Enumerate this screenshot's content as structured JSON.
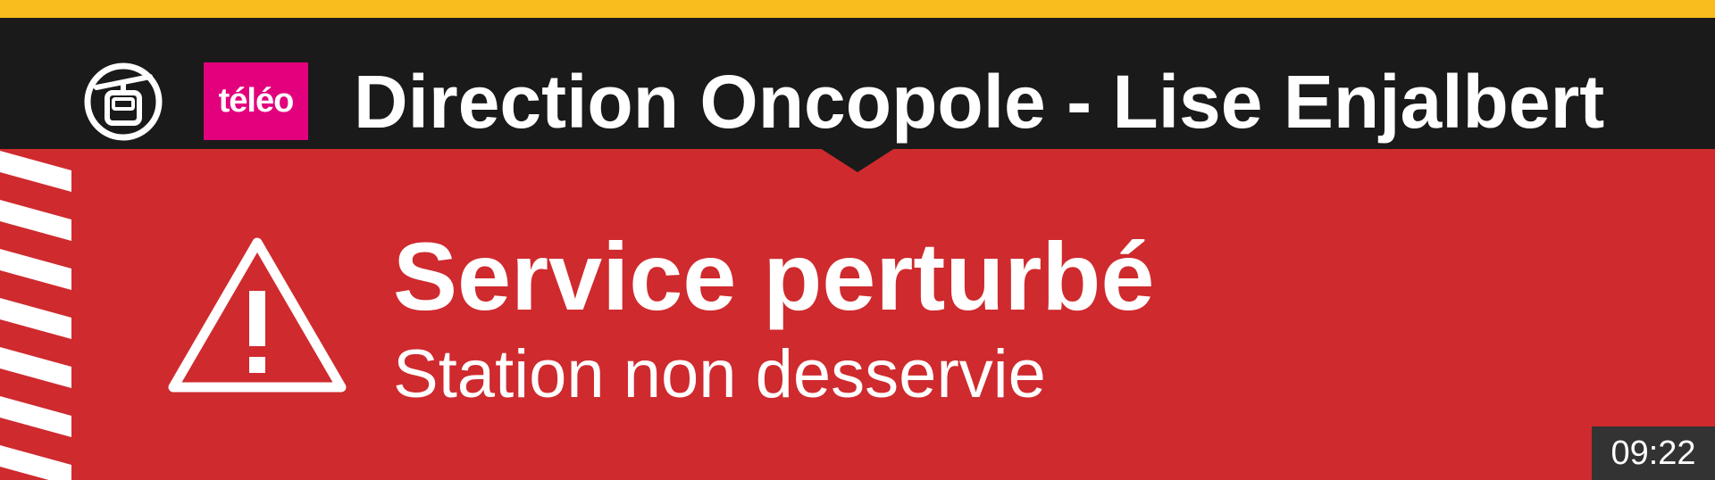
{
  "header": {
    "transport_icon": "cable-car-icon",
    "logo_text": "téléo",
    "direction_title": "Direction Oncopole - Lise Enjalbert"
  },
  "status": {
    "icon": "warning-icon",
    "title": "Service perturbé",
    "subtitle": "Station non desservie"
  },
  "clock": {
    "time": "09:22"
  },
  "colors": {
    "accent_bar": "#f9bd1d",
    "header_background": "#1a1a1a",
    "alert_background": "#cf2a2e",
    "logo_background": "#e3007d",
    "text": "#ffffff"
  }
}
